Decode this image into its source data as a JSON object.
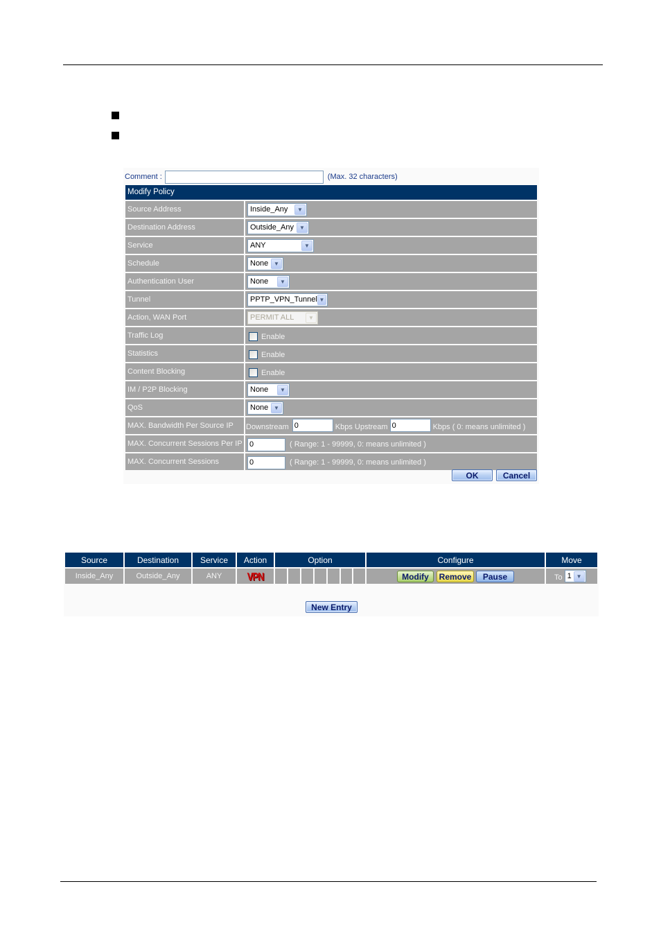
{
  "modify_policy": {
    "comment": {
      "label": "Comment :",
      "value": "",
      "hint": "(Max. 32 characters)"
    },
    "title": "Modify Policy",
    "rows": [
      {
        "label": "Source Address",
        "type": "select",
        "value": "Inside_Any"
      },
      {
        "label": "Destination Address",
        "type": "select",
        "value": "Outside_Any"
      },
      {
        "label": "Service",
        "type": "select",
        "value": "ANY"
      },
      {
        "label": "Schedule",
        "type": "select",
        "value": "None"
      },
      {
        "label": "Authentication User",
        "type": "select",
        "value": "None"
      },
      {
        "label": "Tunnel",
        "type": "select",
        "value": "PPTP_VPN_Tunnel"
      },
      {
        "label": "Action, WAN Port",
        "type": "select",
        "value": "PERMIT ALL",
        "disabled": true
      },
      {
        "label": "Traffic Log",
        "type": "checkbox",
        "text": "Enable",
        "checked": false
      },
      {
        "label": "Statistics",
        "type": "checkbox",
        "text": "Enable",
        "checked": false
      },
      {
        "label": "Content Blocking",
        "type": "checkbox",
        "text": "Enable",
        "checked": false
      },
      {
        "label": "IM / P2P Blocking",
        "type": "select",
        "value": "None"
      },
      {
        "label": "QoS",
        "type": "select",
        "value": "None"
      }
    ],
    "bandwidth": {
      "label": "MAX. Bandwidth Per Source IP",
      "downstream_label": "Downstream",
      "downstream_value": "0",
      "upstream_label": "Kbps Upstream",
      "upstream_value": "0",
      "suffix": "Kbps ( 0: means unlimited )"
    },
    "sessions_per_ip": {
      "label": "MAX. Concurrent Sessions Per IP",
      "value": "0",
      "hint": "( Range: 1 - 99999, 0: means unlimited )"
    },
    "sessions": {
      "label": "MAX. Concurrent Sessions",
      "value": "0",
      "hint": "( Range: 1 - 99999, 0: means unlimited )"
    },
    "ok_label": "OK",
    "cancel_label": "Cancel"
  },
  "policy_list": {
    "headers": {
      "source": "Source",
      "destination": "Destination",
      "service": "Service",
      "action": "Action",
      "option": "Option",
      "configure": "Configure",
      "move": "Move"
    },
    "rows": [
      {
        "source": "Inside_Any",
        "destination": "Outside_Any",
        "service": "ANY",
        "action_icon": "VPN",
        "option_cells": [
          "",
          "",
          "",
          "",
          "",
          "",
          ""
        ],
        "modify_label": "Modify",
        "remove_label": "Remove",
        "pause_label": "Pause",
        "move_to_label": "To",
        "move_value": "1"
      }
    ],
    "new_entry_label": "New Entry"
  }
}
